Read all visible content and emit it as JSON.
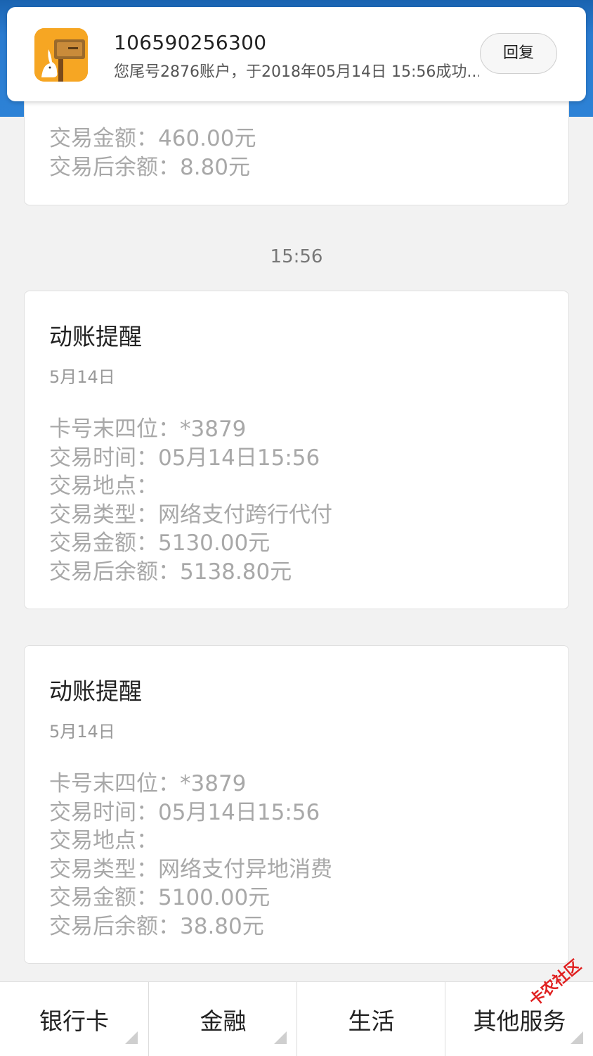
{
  "notification": {
    "sender": "106590256300",
    "preview": "您尾号2876账户，于2018年05月14日 15:56成功...",
    "reply_label": "回复",
    "icon": "bank-mailbox-rabbit-icon"
  },
  "partial_card": {
    "amount": "交易金额：460.00元",
    "balance": "交易后余额：8.80元"
  },
  "time_label": "15:56",
  "cards": [
    {
      "title": "动账提醒",
      "date": "5月14日",
      "card_no": "卡号末四位：*3879",
      "time": "交易时间：05月14日15:56",
      "place": "交易地点：",
      "type": "交易类型：网络支付跨行代付",
      "amount": "交易金额：5130.00元",
      "balance": "交易后余额：5138.80元"
    },
    {
      "title": "动账提醒",
      "date": "5月14日",
      "card_no": "卡号末四位：*3879",
      "time": "交易时间：05月14日15:56",
      "place": "交易地点：",
      "type": "交易类型：网络支付异地消费",
      "amount": "交易金额：5100.00元",
      "balance": "交易后余额：38.80元"
    }
  ],
  "tabs": [
    "银行卡",
    "金融",
    "生活",
    "其他服务"
  ],
  "watermark": "卡农社区",
  "colors": {
    "header_blue": "#2d82d6",
    "app_icon_orange": "#f6a623",
    "watermark_red": "#e02020"
  }
}
